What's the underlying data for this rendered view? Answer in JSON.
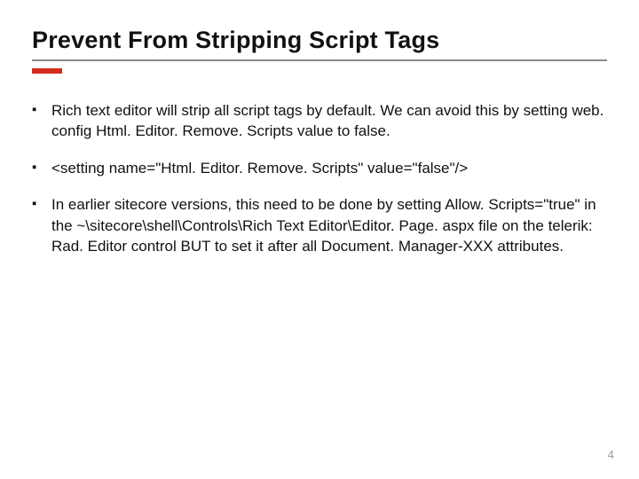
{
  "title": "Prevent  From Stripping Script Tags",
  "bullets": [
    "Rich text editor will strip all script tags by default. We can avoid this by setting web. config Html. Editor. Remove. Scripts value to false.",
    "<setting name=\"Html. Editor. Remove. Scripts\" value=\"false\"/>",
    "In earlier sitecore versions, this need to be done by setting Allow. Scripts=\"true\" in the ~\\sitecore\\shell\\Controls\\Rich Text Editor\\Editor. Page. aspx file on the telerik: Rad. Editor control BUT to set it after all Document. Manager-XXX attributes."
  ],
  "page_number": "4"
}
